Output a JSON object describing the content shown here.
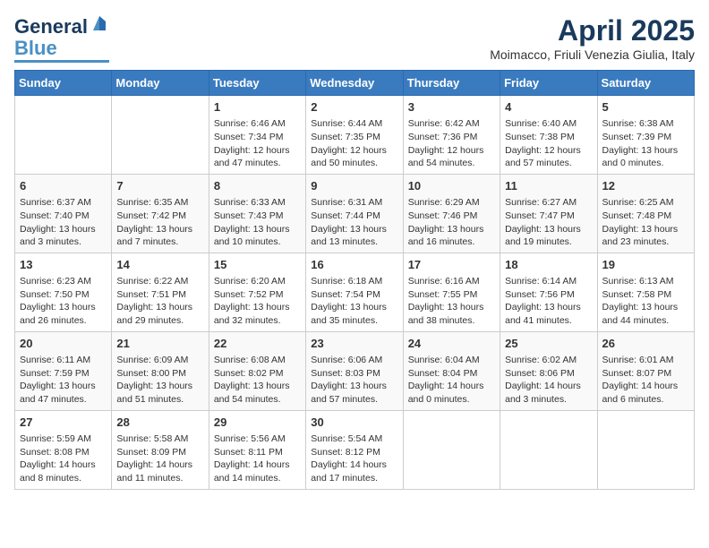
{
  "header": {
    "logo_general": "General",
    "logo_blue": "Blue",
    "month_title": "April 2025",
    "location": "Moimacco, Friuli Venezia Giulia, Italy"
  },
  "columns": [
    "Sunday",
    "Monday",
    "Tuesday",
    "Wednesday",
    "Thursday",
    "Friday",
    "Saturday"
  ],
  "weeks": [
    [
      {
        "day": "",
        "info": ""
      },
      {
        "day": "",
        "info": ""
      },
      {
        "day": "1",
        "info": "Sunrise: 6:46 AM\nSunset: 7:34 PM\nDaylight: 12 hours and 47 minutes."
      },
      {
        "day": "2",
        "info": "Sunrise: 6:44 AM\nSunset: 7:35 PM\nDaylight: 12 hours and 50 minutes."
      },
      {
        "day": "3",
        "info": "Sunrise: 6:42 AM\nSunset: 7:36 PM\nDaylight: 12 hours and 54 minutes."
      },
      {
        "day": "4",
        "info": "Sunrise: 6:40 AM\nSunset: 7:38 PM\nDaylight: 12 hours and 57 minutes."
      },
      {
        "day": "5",
        "info": "Sunrise: 6:38 AM\nSunset: 7:39 PM\nDaylight: 13 hours and 0 minutes."
      }
    ],
    [
      {
        "day": "6",
        "info": "Sunrise: 6:37 AM\nSunset: 7:40 PM\nDaylight: 13 hours and 3 minutes."
      },
      {
        "day": "7",
        "info": "Sunrise: 6:35 AM\nSunset: 7:42 PM\nDaylight: 13 hours and 7 minutes."
      },
      {
        "day": "8",
        "info": "Sunrise: 6:33 AM\nSunset: 7:43 PM\nDaylight: 13 hours and 10 minutes."
      },
      {
        "day": "9",
        "info": "Sunrise: 6:31 AM\nSunset: 7:44 PM\nDaylight: 13 hours and 13 minutes."
      },
      {
        "day": "10",
        "info": "Sunrise: 6:29 AM\nSunset: 7:46 PM\nDaylight: 13 hours and 16 minutes."
      },
      {
        "day": "11",
        "info": "Sunrise: 6:27 AM\nSunset: 7:47 PM\nDaylight: 13 hours and 19 minutes."
      },
      {
        "day": "12",
        "info": "Sunrise: 6:25 AM\nSunset: 7:48 PM\nDaylight: 13 hours and 23 minutes."
      }
    ],
    [
      {
        "day": "13",
        "info": "Sunrise: 6:23 AM\nSunset: 7:50 PM\nDaylight: 13 hours and 26 minutes."
      },
      {
        "day": "14",
        "info": "Sunrise: 6:22 AM\nSunset: 7:51 PM\nDaylight: 13 hours and 29 minutes."
      },
      {
        "day": "15",
        "info": "Sunrise: 6:20 AM\nSunset: 7:52 PM\nDaylight: 13 hours and 32 minutes."
      },
      {
        "day": "16",
        "info": "Sunrise: 6:18 AM\nSunset: 7:54 PM\nDaylight: 13 hours and 35 minutes."
      },
      {
        "day": "17",
        "info": "Sunrise: 6:16 AM\nSunset: 7:55 PM\nDaylight: 13 hours and 38 minutes."
      },
      {
        "day": "18",
        "info": "Sunrise: 6:14 AM\nSunset: 7:56 PM\nDaylight: 13 hours and 41 minutes."
      },
      {
        "day": "19",
        "info": "Sunrise: 6:13 AM\nSunset: 7:58 PM\nDaylight: 13 hours and 44 minutes."
      }
    ],
    [
      {
        "day": "20",
        "info": "Sunrise: 6:11 AM\nSunset: 7:59 PM\nDaylight: 13 hours and 47 minutes."
      },
      {
        "day": "21",
        "info": "Sunrise: 6:09 AM\nSunset: 8:00 PM\nDaylight: 13 hours and 51 minutes."
      },
      {
        "day": "22",
        "info": "Sunrise: 6:08 AM\nSunset: 8:02 PM\nDaylight: 13 hours and 54 minutes."
      },
      {
        "day": "23",
        "info": "Sunrise: 6:06 AM\nSunset: 8:03 PM\nDaylight: 13 hours and 57 minutes."
      },
      {
        "day": "24",
        "info": "Sunrise: 6:04 AM\nSunset: 8:04 PM\nDaylight: 14 hours and 0 minutes."
      },
      {
        "day": "25",
        "info": "Sunrise: 6:02 AM\nSunset: 8:06 PM\nDaylight: 14 hours and 3 minutes."
      },
      {
        "day": "26",
        "info": "Sunrise: 6:01 AM\nSunset: 8:07 PM\nDaylight: 14 hours and 6 minutes."
      }
    ],
    [
      {
        "day": "27",
        "info": "Sunrise: 5:59 AM\nSunset: 8:08 PM\nDaylight: 14 hours and 8 minutes."
      },
      {
        "day": "28",
        "info": "Sunrise: 5:58 AM\nSunset: 8:09 PM\nDaylight: 14 hours and 11 minutes."
      },
      {
        "day": "29",
        "info": "Sunrise: 5:56 AM\nSunset: 8:11 PM\nDaylight: 14 hours and 14 minutes."
      },
      {
        "day": "30",
        "info": "Sunrise: 5:54 AM\nSunset: 8:12 PM\nDaylight: 14 hours and 17 minutes."
      },
      {
        "day": "",
        "info": ""
      },
      {
        "day": "",
        "info": ""
      },
      {
        "day": "",
        "info": ""
      }
    ]
  ]
}
